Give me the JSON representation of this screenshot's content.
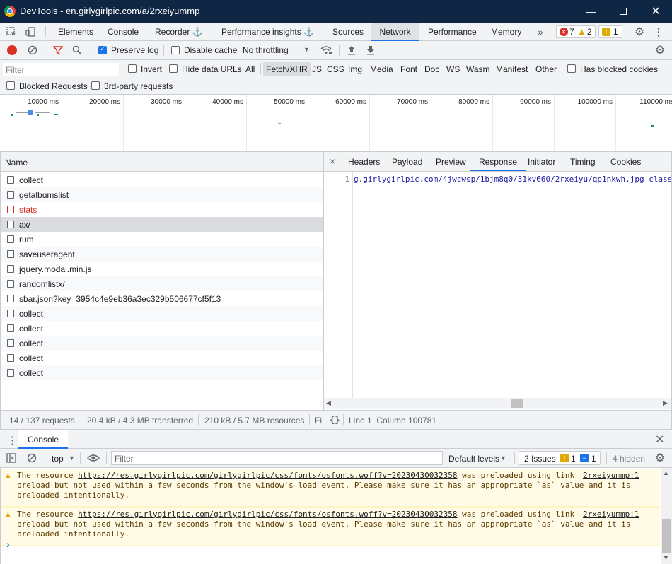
{
  "window": {
    "title": "DevTools - en.girlygirlpic.com/a/2rxeiyummp"
  },
  "main_tabs": {
    "elements": "Elements",
    "console": "Console",
    "recorder": "Recorder",
    "perf_insights": "Performance insights",
    "sources": "Sources",
    "network": "Network",
    "performance": "Performance",
    "memory": "Memory",
    "more": "»",
    "errors": "7",
    "warnings": "2",
    "issues": "1"
  },
  "network_toolbar": {
    "preserve_log": "Preserve log",
    "disable_cache": "Disable cache",
    "throttling": "No throttling"
  },
  "filter_bar": {
    "placeholder": "Filter",
    "invert": "Invert",
    "hide_data_urls": "Hide data URLs",
    "types": [
      "All",
      "Fetch/XHR",
      "JS",
      "CSS",
      "Img",
      "Media",
      "Font",
      "Doc",
      "WS",
      "Wasm",
      "Manifest",
      "Other"
    ],
    "has_blocked_cookies": "Has blocked cookies",
    "blocked_requests": "Blocked Requests",
    "third_party": "3rd-party requests"
  },
  "timeline": {
    "ticks": [
      "10000 ms",
      "20000 ms",
      "30000 ms",
      "40000 ms",
      "50000 ms",
      "60000 ms",
      "70000 ms",
      "80000 ms",
      "90000 ms",
      "100000 ms",
      "110000 ms"
    ]
  },
  "request_list": {
    "header": "Name",
    "rows": [
      {
        "name": "collect",
        "status": "normal"
      },
      {
        "name": "getalbumslist",
        "status": "normal"
      },
      {
        "name": "stats",
        "status": "error"
      },
      {
        "name": "ax/",
        "status": "selected"
      },
      {
        "name": "rum",
        "status": "normal"
      },
      {
        "name": "saveuseragent",
        "status": "normal"
      },
      {
        "name": "jquery.modal.min.js",
        "status": "normal"
      },
      {
        "name": "randomlistx/",
        "status": "normal"
      },
      {
        "name": "sbar.json?key=3954c4e9eb36a3ec329b506677cf5f13",
        "status": "normal"
      },
      {
        "name": "collect",
        "status": "normal"
      },
      {
        "name": "collect",
        "status": "normal"
      },
      {
        "name": "collect",
        "status": "normal"
      },
      {
        "name": "collect",
        "status": "normal"
      },
      {
        "name": "collect",
        "status": "normal"
      }
    ]
  },
  "status_bar": {
    "requests": "14 / 137 requests",
    "transferred": "20.4 kB / 4.3 MB transferred",
    "resources": "210 kB / 5.7 MB resources",
    "finish": "Fi"
  },
  "detail_tabs": {
    "close": "×",
    "headers": "Headers",
    "payload": "Payload",
    "preview": "Preview",
    "response": "Response",
    "initiator": "Initiator",
    "timing": "Timing",
    "cookies": "Cookies"
  },
  "response": {
    "line_no": "1",
    "text": "g.girlygirlpic.com/4jwcwsp/1bjm8q0/31kv660/2rxeiyu/qp1nkwh.jpg class=",
    "position": "Line 1, Column 100781",
    "braces": "{}"
  },
  "drawer": {
    "tab": "Console",
    "context": "top",
    "filter_placeholder": "Filter",
    "levels": "Default levels",
    "issues_label": "2 Issues:",
    "issues_warn": "1",
    "issues_info": "1",
    "hidden": "4 hidden",
    "messages": [
      {
        "prefix": "The resource ",
        "url": "https://res.girlygirlpic.com/girlygirlpic/css/fonts/osfonts.woff?v=20230430032358",
        "suffix": " was preloaded using link",
        "line2": "preload but not used within a few seconds from the window's load event. Please make sure it has an appropriate `as` value and it is",
        "line3": "preloaded intentionally.",
        "source": "2rxeiyummp:1"
      },
      {
        "prefix": "The resource ",
        "url": "https://res.girlygirlpic.com/girlygirlpic/css/fonts/osfonts.woff?v=20230430032358",
        "suffix": " was preloaded using link",
        "line2": "preload but not used within a few seconds from the window's load event. Please make sure it has an appropriate `as` value and it is",
        "line3": "preloaded intentionally.",
        "source": "2rxeiyummp:1"
      }
    ],
    "prompt": "›"
  },
  "colors": {
    "accent": "#1a73e8",
    "error": "#d93025",
    "titlebar": "#0f2745",
    "warning_bg": "#fffbe6"
  }
}
